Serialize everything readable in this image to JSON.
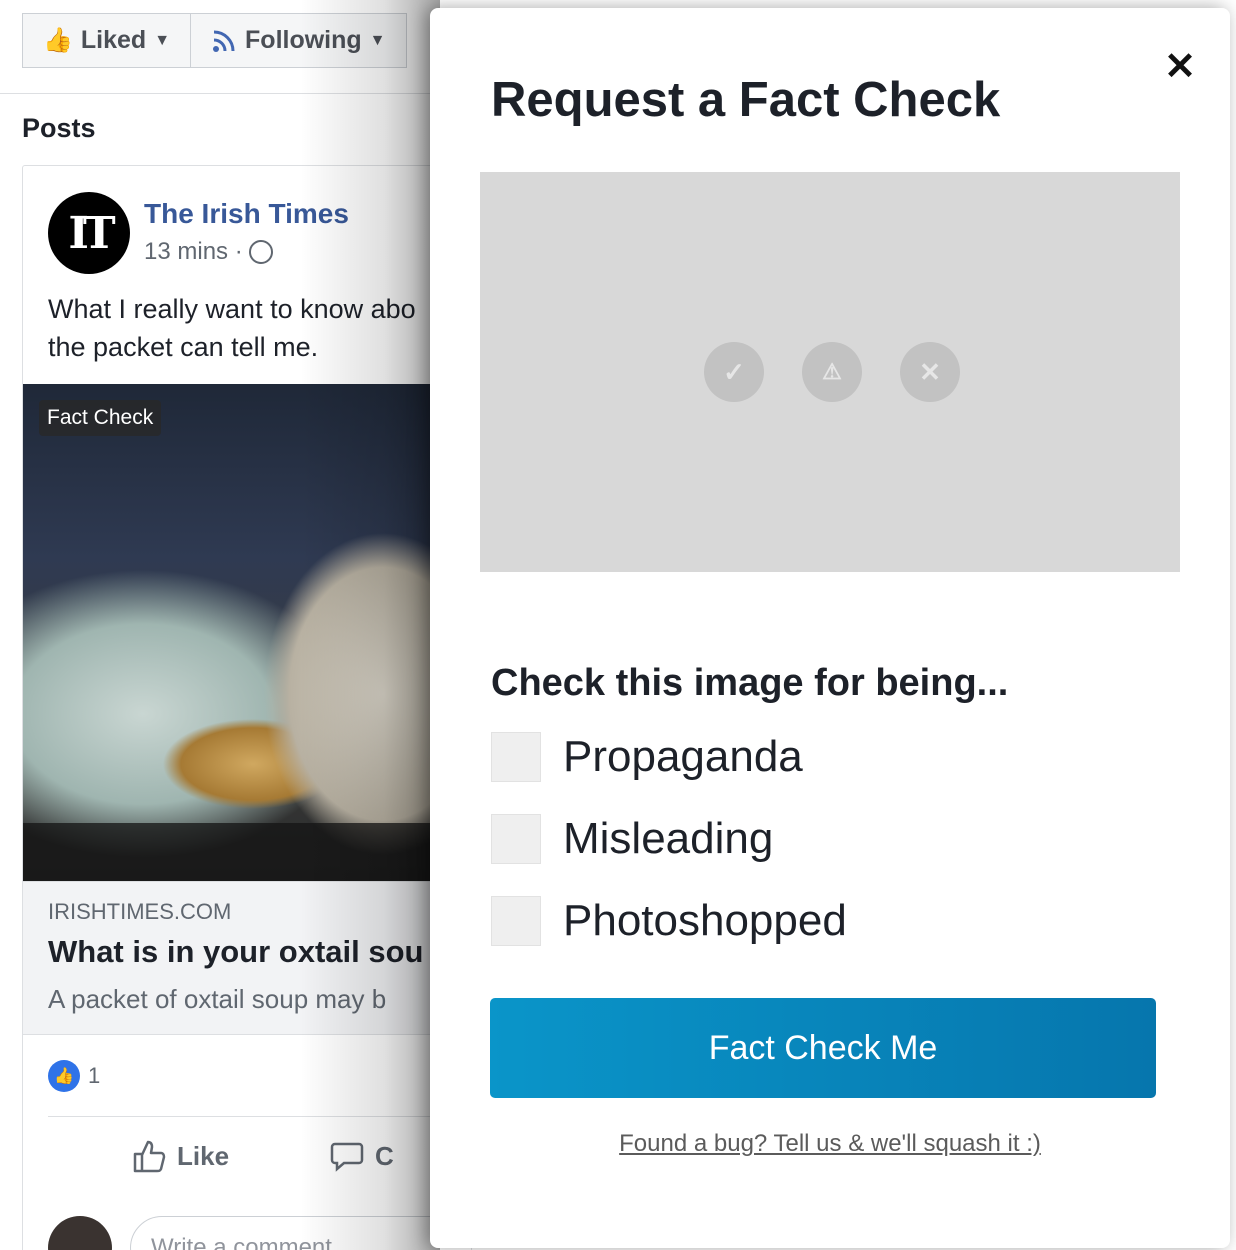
{
  "page": {
    "liked_label": "Liked",
    "following_label": "Following",
    "posts_heading": "Posts"
  },
  "post": {
    "avatar_text": "IT",
    "page_name": "The Irish Times",
    "time": "13 mins ·",
    "text_line1": "What I really want to know abo",
    "text_line2": "the packet can tell me.",
    "fact_check_badge": "Fact Check",
    "link_domain": "IRISHTIMES.COM",
    "link_title": "What is in your oxtail sou",
    "link_desc": "A packet of oxtail soup may b",
    "like_count": "1",
    "like_action": "Like",
    "comment_action": "C",
    "comment_placeholder": "Write a comment..."
  },
  "modal": {
    "title": "Request a Fact Check",
    "close_symbol": "✕",
    "status_icons": [
      "✓",
      "⚠",
      "✕"
    ],
    "heading": "Check this image for being...",
    "options": [
      {
        "label": "Propaganda",
        "checked": false
      },
      {
        "label": "Misleading",
        "checked": false
      },
      {
        "label": "Photoshopped",
        "checked": false
      }
    ],
    "submit_label": "Fact Check Me",
    "bug_link": "Found a bug? Tell us & we'll squash it :)"
  },
  "colors": {
    "accent_start": "#0a95c9",
    "accent_end": "#0676ad",
    "fb_link": "#385898"
  }
}
